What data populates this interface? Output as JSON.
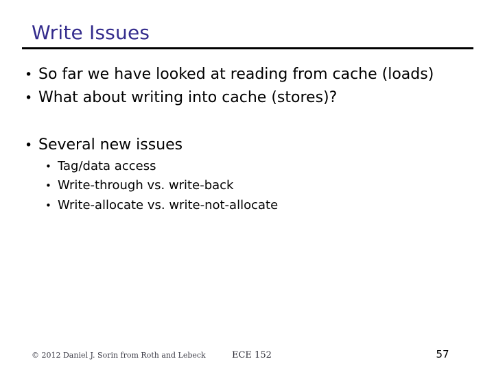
{
  "slide": {
    "title": "Write Issues",
    "title_color": "#332B8C",
    "background_color": "#FFFFFF",
    "rule_color": "#000000",
    "bullet_glyph": "•"
  },
  "body": {
    "level1": [
      {
        "text": "So far we have looked at reading from cache (loads)"
      },
      {
        "text": "What about writing into cache (stores)?"
      },
      {
        "text": "Several new issues"
      }
    ],
    "level2": [
      {
        "text": "Tag/data access"
      },
      {
        "text": "Write-through vs. write-back"
      },
      {
        "text": "Write-allocate vs. write-not-allocate"
      }
    ]
  },
  "footer": {
    "copyright": "© 2012 Daniel J. Sorin from Roth and Lebeck",
    "course": "ECE 152",
    "page_number": "57"
  }
}
